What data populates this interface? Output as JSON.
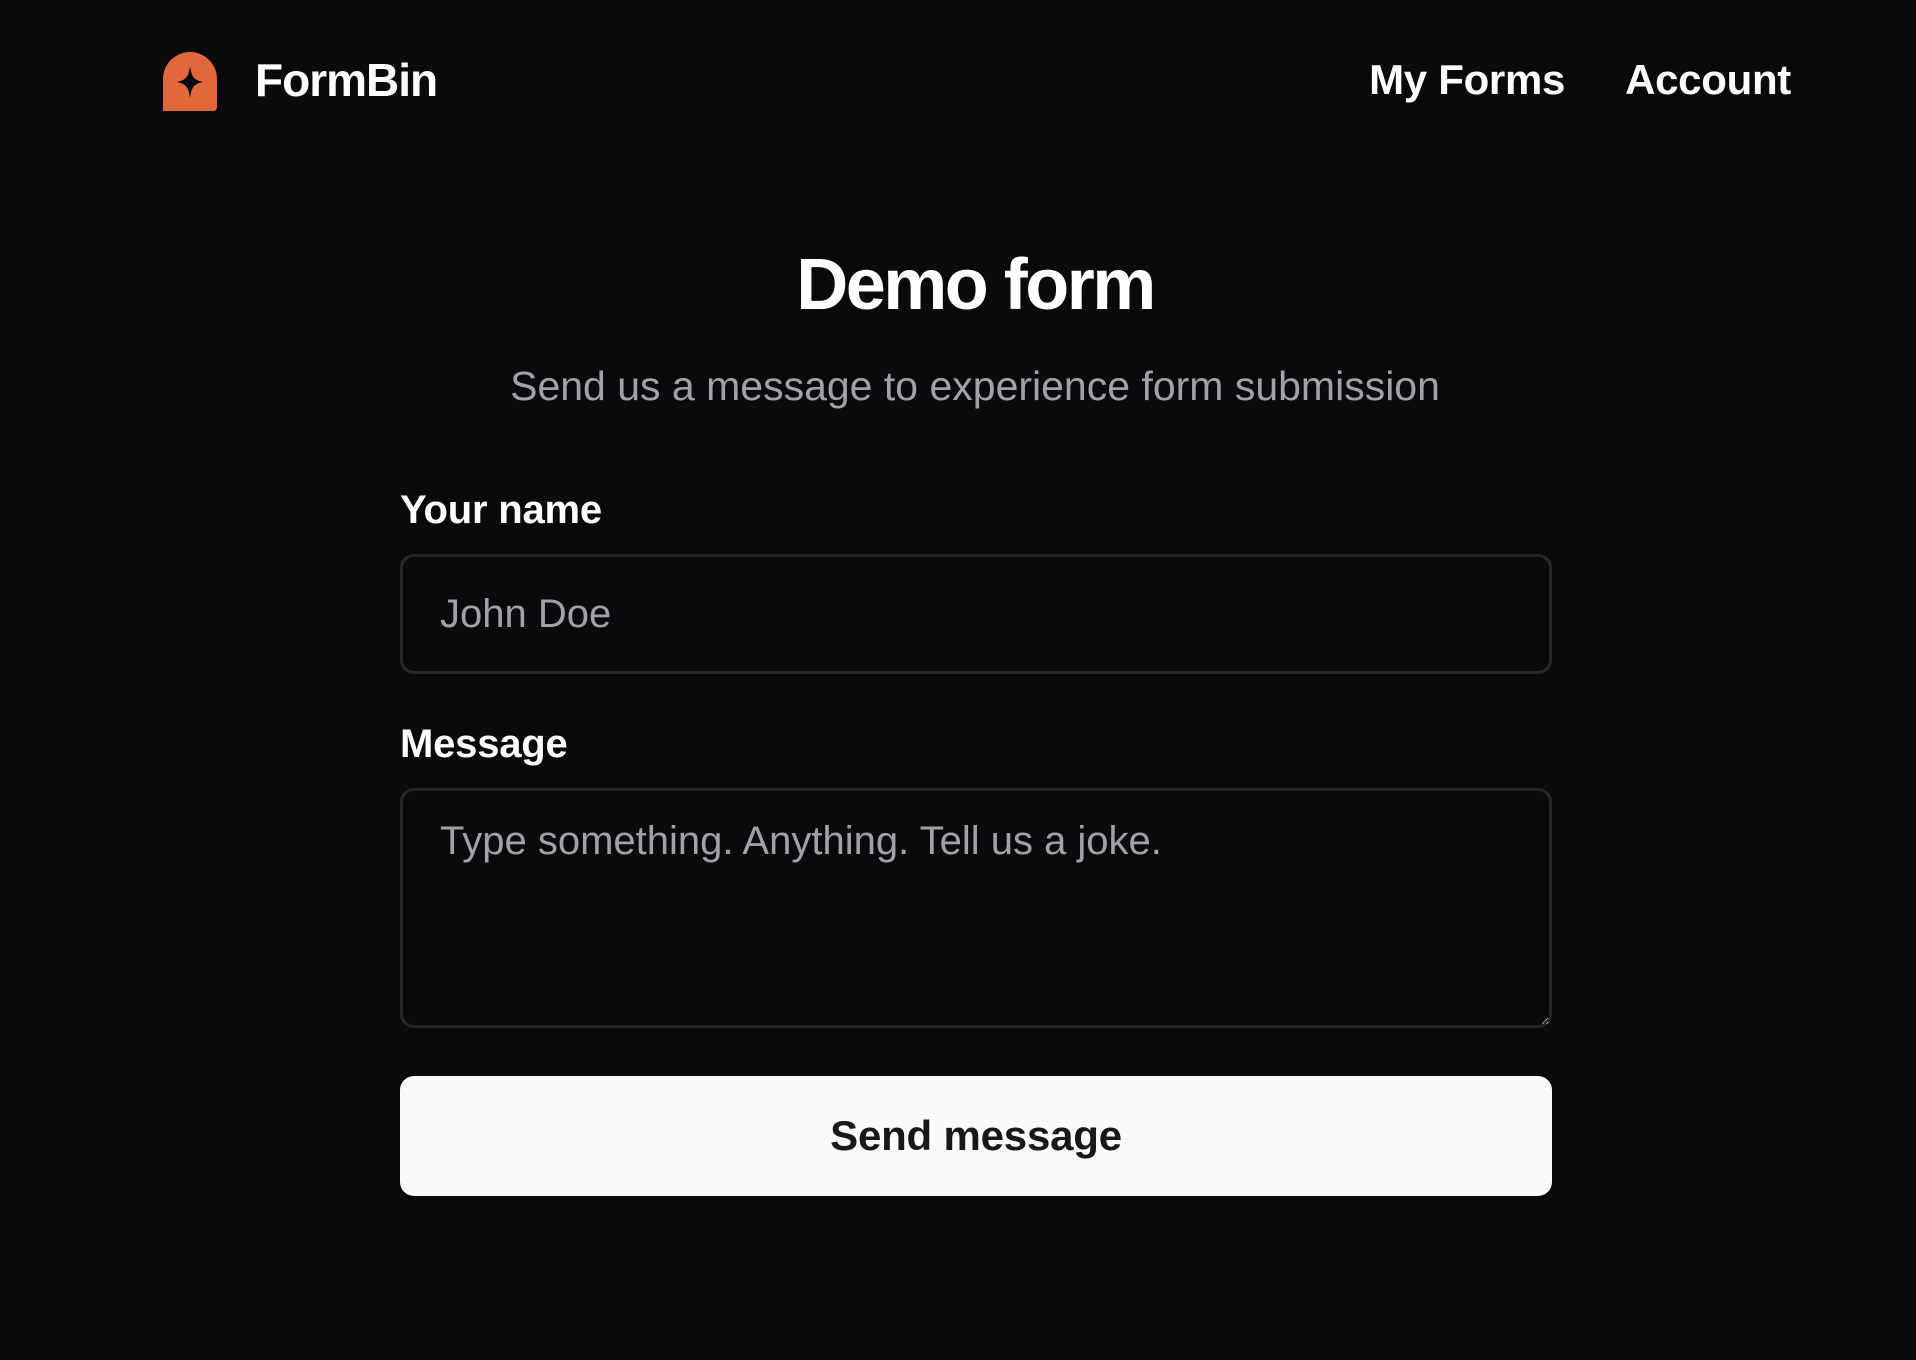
{
  "header": {
    "brand_name": "FormBin",
    "logo_icon": "formbin-logo-icon",
    "nav": [
      {
        "label": "My Forms"
      },
      {
        "label": "Account"
      }
    ]
  },
  "hero": {
    "title": "Demo form",
    "subtitle": "Send us a message to experience form submission"
  },
  "form": {
    "name_label": "Your name",
    "name_placeholder": "John Doe",
    "name_value": "",
    "message_label": "Message",
    "message_placeholder": "Type something. Anything. Tell us a joke.",
    "message_value": "",
    "submit_label": "Send message"
  },
  "colors": {
    "background": "#0a0a0c",
    "brand_accent": "#e2673a",
    "muted_text": "#a1a1aa",
    "border": "#27272a",
    "button_bg": "#fafafa",
    "button_text": "#18181b"
  }
}
